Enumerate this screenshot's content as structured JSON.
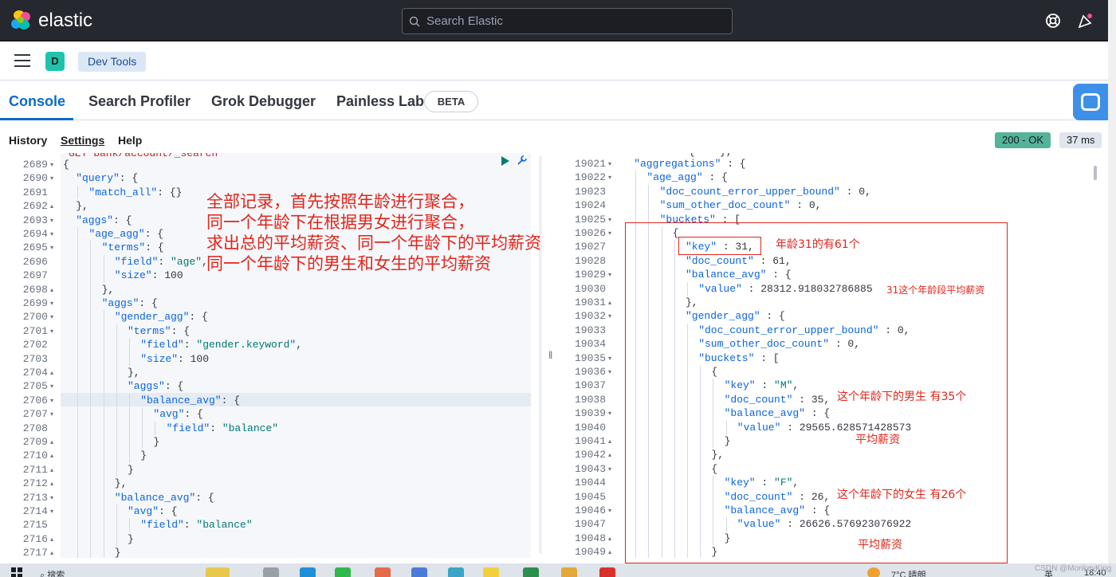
{
  "header": {
    "brand": "elastic",
    "search_placeholder": "Search Elastic",
    "icons": [
      "elastic-logo-icon",
      "search-icon",
      "help-lifebuoy-icon",
      "news-feed-icon"
    ]
  },
  "breadcrumb": {
    "space_avatar": "D",
    "item": "Dev Tools"
  },
  "tabs": {
    "items": [
      "Console",
      "Search Profiler",
      "Grok Debugger",
      "Painless Lab"
    ],
    "active": "Console",
    "beta_badge": "BETA"
  },
  "console_toolbar": {
    "history": "History",
    "settings": "Settings",
    "help": "Help",
    "status_code": "200 - OK",
    "duration": "37 ms"
  },
  "request": {
    "partial_first_line": "GET bank/account/_search",
    "lines": [
      {
        "n": "2689",
        "fold": "▾",
        "indent": 0,
        "text": "{"
      },
      {
        "n": "2690",
        "fold": "▾",
        "indent": 1,
        "text": "\"query\": {"
      },
      {
        "n": "2691",
        "fold": "",
        "indent": 2,
        "text": "\"match_all\": {}"
      },
      {
        "n": "2692",
        "fold": "▴",
        "indent": 1,
        "text": "},"
      },
      {
        "n": "2693",
        "fold": "▾",
        "indent": 1,
        "text": "\"aggs\": {"
      },
      {
        "n": "2694",
        "fold": "▾",
        "indent": 2,
        "text": "\"age_agg\": {"
      },
      {
        "n": "2695",
        "fold": "▾",
        "indent": 3,
        "text": "\"terms\": {"
      },
      {
        "n": "2696",
        "fold": "",
        "indent": 4,
        "text": "\"field\": \"age\","
      },
      {
        "n": "2697",
        "fold": "",
        "indent": 4,
        "text": "\"size\": 100"
      },
      {
        "n": "2698",
        "fold": "▴",
        "indent": 3,
        "text": "},"
      },
      {
        "n": "2699",
        "fold": "▾",
        "indent": 3,
        "text": "\"aggs\": {"
      },
      {
        "n": "2700",
        "fold": "▾",
        "indent": 4,
        "text": "\"gender_agg\": {"
      },
      {
        "n": "2701",
        "fold": "▾",
        "indent": 5,
        "text": "\"terms\": {"
      },
      {
        "n": "2702",
        "fold": "",
        "indent": 6,
        "text": "\"field\": \"gender.keyword\","
      },
      {
        "n": "2703",
        "fold": "",
        "indent": 6,
        "text": "\"size\": 100"
      },
      {
        "n": "2704",
        "fold": "▴",
        "indent": 5,
        "text": "},"
      },
      {
        "n": "2705",
        "fold": "▾",
        "indent": 5,
        "text": "\"aggs\": {"
      },
      {
        "n": "2706",
        "fold": "▾",
        "indent": 6,
        "text": "\"balance_avg\": {"
      },
      {
        "n": "2707",
        "fold": "▾",
        "indent": 7,
        "text": "\"avg\": {"
      },
      {
        "n": "2708",
        "fold": "",
        "indent": 8,
        "text": "\"field\": \"balance\""
      },
      {
        "n": "2709",
        "fold": "▴",
        "indent": 7,
        "text": "}"
      },
      {
        "n": "2710",
        "fold": "▴",
        "indent": 6,
        "text": "}"
      },
      {
        "n": "2711",
        "fold": "▴",
        "indent": 5,
        "text": "}"
      },
      {
        "n": "2712",
        "fold": "▴",
        "indent": 4,
        "text": "},"
      },
      {
        "n": "2713",
        "fold": "▾",
        "indent": 4,
        "text": "\"balance_avg\": {"
      },
      {
        "n": "2714",
        "fold": "▾",
        "indent": 5,
        "text": "\"avg\": {"
      },
      {
        "n": "2715",
        "fold": "",
        "indent": 6,
        "text": "\"field\": \"balance\""
      },
      {
        "n": "2716",
        "fold": "▴",
        "indent": 5,
        "text": "}"
      },
      {
        "n": "2717",
        "fold": "▴",
        "indent": 4,
        "text": "}"
      }
    ]
  },
  "response": {
    "lines": [
      {
        "n": "19021",
        "fold": "▾",
        "indent": 1,
        "text": "\"aggregations\" : {"
      },
      {
        "n": "19022",
        "fold": "▾",
        "indent": 2,
        "text": "\"age_agg\" : {"
      },
      {
        "n": "19023",
        "fold": "",
        "indent": 3,
        "text": "\"doc_count_error_upper_bound\" : 0,"
      },
      {
        "n": "19024",
        "fold": "",
        "indent": 3,
        "text": "\"sum_other_doc_count\" : 0,"
      },
      {
        "n": "19025",
        "fold": "▾",
        "indent": 3,
        "text": "\"buckets\" : ["
      },
      {
        "n": "19026",
        "fold": "▾",
        "indent": 4,
        "text": "{"
      },
      {
        "n": "19027",
        "fold": "",
        "indent": 5,
        "text": "\"key\" : 31,"
      },
      {
        "n": "19028",
        "fold": "",
        "indent": 5,
        "text": "\"doc_count\" : 61,"
      },
      {
        "n": "19029",
        "fold": "▾",
        "indent": 5,
        "text": "\"balance_avg\" : {"
      },
      {
        "n": "19030",
        "fold": "",
        "indent": 6,
        "text": "\"value\" : 28312.918032786885"
      },
      {
        "n": "19031",
        "fold": "▴",
        "indent": 5,
        "text": "},"
      },
      {
        "n": "19032",
        "fold": "▾",
        "indent": 5,
        "text": "\"gender_agg\" : {"
      },
      {
        "n": "19033",
        "fold": "",
        "indent": 6,
        "text": "\"doc_count_error_upper_bound\" : 0,"
      },
      {
        "n": "19034",
        "fold": "",
        "indent": 6,
        "text": "\"sum_other_doc_count\" : 0,"
      },
      {
        "n": "19035",
        "fold": "▾",
        "indent": 6,
        "text": "\"buckets\" : ["
      },
      {
        "n": "19036",
        "fold": "▾",
        "indent": 7,
        "text": "{"
      },
      {
        "n": "19037",
        "fold": "",
        "indent": 8,
        "text": "\"key\" : \"M\","
      },
      {
        "n": "19038",
        "fold": "",
        "indent": 8,
        "text": "\"doc_count\" : 35,"
      },
      {
        "n": "19039",
        "fold": "▾",
        "indent": 8,
        "text": "\"balance_avg\" : {"
      },
      {
        "n": "19040",
        "fold": "",
        "indent": 9,
        "text": "\"value\" : 29565.628571428573"
      },
      {
        "n": "19041",
        "fold": "▴",
        "indent": 8,
        "text": "}"
      },
      {
        "n": "19042",
        "fold": "▴",
        "indent": 7,
        "text": "},"
      },
      {
        "n": "19043",
        "fold": "▾",
        "indent": 7,
        "text": "{"
      },
      {
        "n": "19044",
        "fold": "",
        "indent": 8,
        "text": "\"key\" : \"F\","
      },
      {
        "n": "19045",
        "fold": "",
        "indent": 8,
        "text": "\"doc_count\" : 26,"
      },
      {
        "n": "19046",
        "fold": "▾",
        "indent": 8,
        "text": "\"balance_avg\" : {"
      },
      {
        "n": "19047",
        "fold": "",
        "indent": 9,
        "text": "\"value\" : 26626.576923076922"
      },
      {
        "n": "19048",
        "fold": "▴",
        "indent": 8,
        "text": "}"
      },
      {
        "n": "19049",
        "fold": "▴",
        "indent": 7,
        "text": "}"
      }
    ]
  },
  "annotations": {
    "request_note": [
      "全部记录，首先按照年龄进行聚合，",
      "同一个年龄下在根据男女进行聚合，",
      "求出总的平均薪资、同一个年龄下的平均薪资",
      "同一个年龄下的男生和女生的平均薪资"
    ],
    "key_note": "年龄31的有61个",
    "age_avg_note": "31这个年龄段平均薪资",
    "male_note": "这个年龄下的男生 有35个",
    "male_avg_note": "平均薪资",
    "female_note": "这个年龄下的女生 有26个",
    "female_avg_note": "平均薪资"
  },
  "taskbar": {
    "search_text": "搜索",
    "weather": "7°C 晴朗",
    "ime": "英",
    "clock": "18:40"
  },
  "watermark": "CSDN @MonkeyKing"
}
